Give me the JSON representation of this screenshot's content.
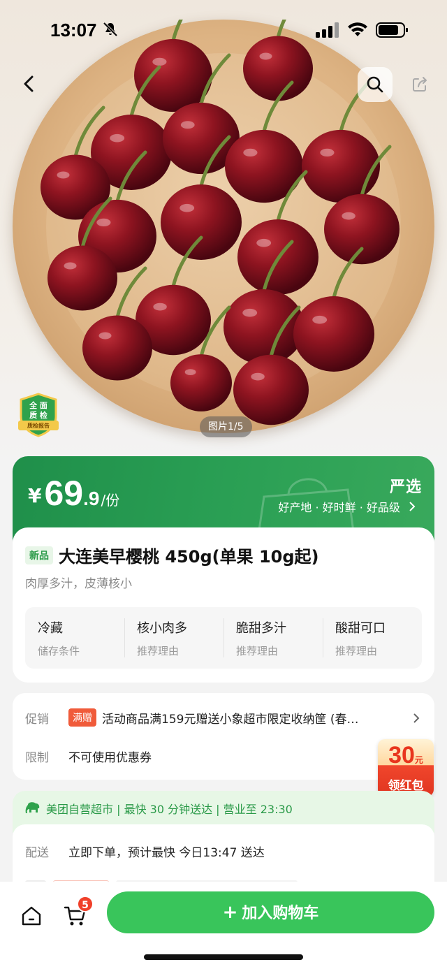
{
  "status_bar": {
    "time": "13:07"
  },
  "hero": {
    "image_counter": "图片1/5",
    "quality_badge_line1": "全 面",
    "quality_badge_line2": "质 检",
    "quality_badge_line3": "质检报告"
  },
  "price": {
    "currency": "¥",
    "integer": "69",
    "decimal": ".9",
    "unit": "/份"
  },
  "brand": {
    "logo": "严选",
    "tags": "好产地 · 好时鲜 · 好品级"
  },
  "product": {
    "new_tag": "新品",
    "title": "大连美早樱桃 450g(单果 10g起)",
    "subtitle": "肉厚多汁，皮薄核小",
    "features": [
      {
        "title": "冷藏",
        "sub": "储存条件"
      },
      {
        "title": "核小肉多",
        "sub": "推荐理由"
      },
      {
        "title": "脆甜多汁",
        "sub": "推荐理由"
      },
      {
        "title": "酸甜可口",
        "sub": "推荐理由"
      }
    ]
  },
  "promo": {
    "label": "促销",
    "gift_tag": "满赠",
    "text": "活动商品满159元赠送小象超市限定收纳筐 (春…",
    "limit_label": "限制",
    "limit_text": "不可使用优惠券"
  },
  "red_packet": {
    "amount": "30",
    "unit": "元",
    "label": "领红包"
  },
  "delivery": {
    "strip": "美团自营超市 | 最快 30 分钟送达 | 营业至 23:30",
    "label": "配送",
    "text": "立即下单，预计最快 今日13:47 送达"
  },
  "bottom": {
    "cart_count": "5",
    "add_to_cart": "加入购物车"
  },
  "colors": {
    "brand_green": "#2a9f54",
    "button_green": "#39c55b",
    "badge_red": "#f0402a"
  },
  "icons": [
    "back-icon",
    "search-icon",
    "share-icon",
    "home-icon",
    "cart-icon",
    "elephant-icon",
    "chevron-right-icon"
  ]
}
